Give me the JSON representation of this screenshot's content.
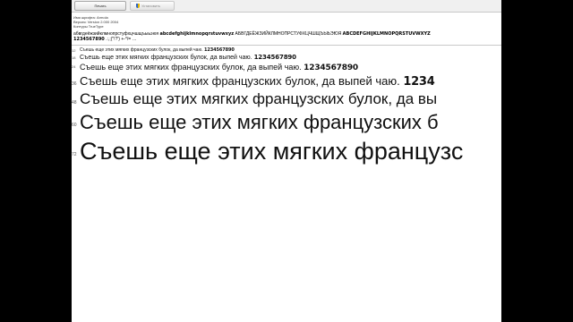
{
  "toolbar": {
    "print_label": "Печать",
    "install_label": "Установить"
  },
  "meta": {
    "font_name": "Имя шрифта: Armola",
    "version": "Версия: Version 2.000 2004",
    "outlines": "Контуры TrueType"
  },
  "charset": {
    "lowercase": "абвгдеёжзийклмнопрстуфхцчшщъыьэюя",
    "lowercase_deco": "abcdefghijklmnopqrstuvwxyz",
    "uppercase": "АБВГДЕЁЖЗИЙКЛМНОПРСТУФХЦЧШЩЪЫЬЭЮЯ",
    "uppercase_deco": "ABCDEFGHIJKLMNOPQRSTUVWXYZ",
    "digits_deco": "1234567890",
    "punctuation": ".:,;(\"!?') +-*/=",
    "ellipsis": "…"
  },
  "samples": [
    {
      "size": "12",
      "text": "Съешь еще этих мягких французских булок, да выпей чаю.",
      "digits": "1234567890"
    },
    {
      "size": "18",
      "text": "Съешь еще этих мягких французских булок, да выпей чаю.",
      "digits": "1234567890"
    },
    {
      "size": "24",
      "text": "Съешь еще этих мягких французских булок, да выпей чаю.",
      "digits": "1234567890"
    },
    {
      "size": "36",
      "text": "Съешь еще этих мягких французских булок, да выпей чаю.",
      "digits": "1234"
    },
    {
      "size": "48",
      "text": "Съешь еще этих мягких французских булок, да вы",
      "digits": ""
    },
    {
      "size": "60",
      "text": "Съешь еще этих мягких французских б",
      "digits": ""
    },
    {
      "size": "72",
      "text": "Съешь еще этих мягких французс",
      "digits": ""
    }
  ]
}
